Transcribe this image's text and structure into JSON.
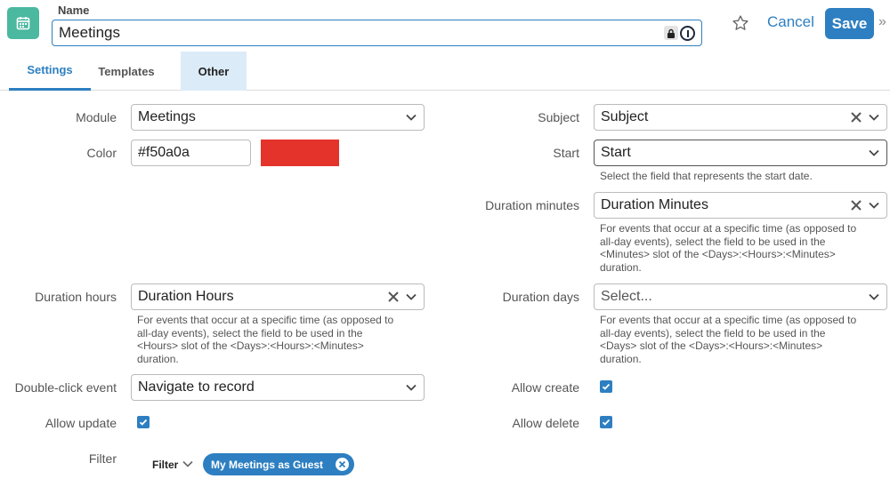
{
  "header": {
    "name_label": "Name",
    "name_value": "Meetings",
    "cancel_label": "Cancel",
    "save_label": "Save",
    "more_glyph": "»"
  },
  "tabs": [
    {
      "label": "Settings",
      "active": true
    },
    {
      "label": "Templates"
    },
    {
      "label": "Other"
    }
  ],
  "form": {
    "module": {
      "label": "Module",
      "value": "Meetings"
    },
    "color": {
      "label": "Color",
      "value": "#f50a0a",
      "swatch": "#e3332b"
    },
    "subject": {
      "label": "Subject",
      "value": "Subject"
    },
    "start": {
      "label": "Start",
      "value": "Start",
      "help": "Select the field that represents the start date."
    },
    "duration_minutes": {
      "label": "Duration minutes",
      "value": "Duration Minutes",
      "help": [
        "For events that occur at a specific time (as opposed to",
        "all-day events), select the field to be used in the",
        "<Minutes> slot of the <Days>:<Hours>:<Minutes>",
        "duration."
      ]
    },
    "duration_hours": {
      "label": "Duration hours",
      "value": "Duration Hours",
      "help": [
        "For events that occur at a specific time (as opposed to",
        "all-day events), select the field to be used in the",
        "<Hours> slot of the <Days>:<Hours>:<Minutes>",
        "duration."
      ]
    },
    "duration_days": {
      "label": "Duration days",
      "placeholder": "Select...",
      "help": [
        "For events that occur at a specific time (as opposed to",
        "all-day events), select the field to be used in the",
        "<Days> slot of the <Days>:<Hours>:<Minutes>",
        "duration."
      ]
    },
    "double_click": {
      "label": "Double-click event",
      "value": "Navigate to record"
    },
    "allow_create": {
      "label": "Allow create",
      "checked": true
    },
    "allow_update": {
      "label": "Allow update",
      "checked": true
    },
    "allow_delete": {
      "label": "Allow delete",
      "checked": true
    },
    "filter": {
      "label": "Filter",
      "dropdown_label": "Filter",
      "chip": "My Meetings as Guest"
    }
  },
  "colors": {
    "accent": "#2d7fc1",
    "app_icon": "#4bb8a0"
  }
}
